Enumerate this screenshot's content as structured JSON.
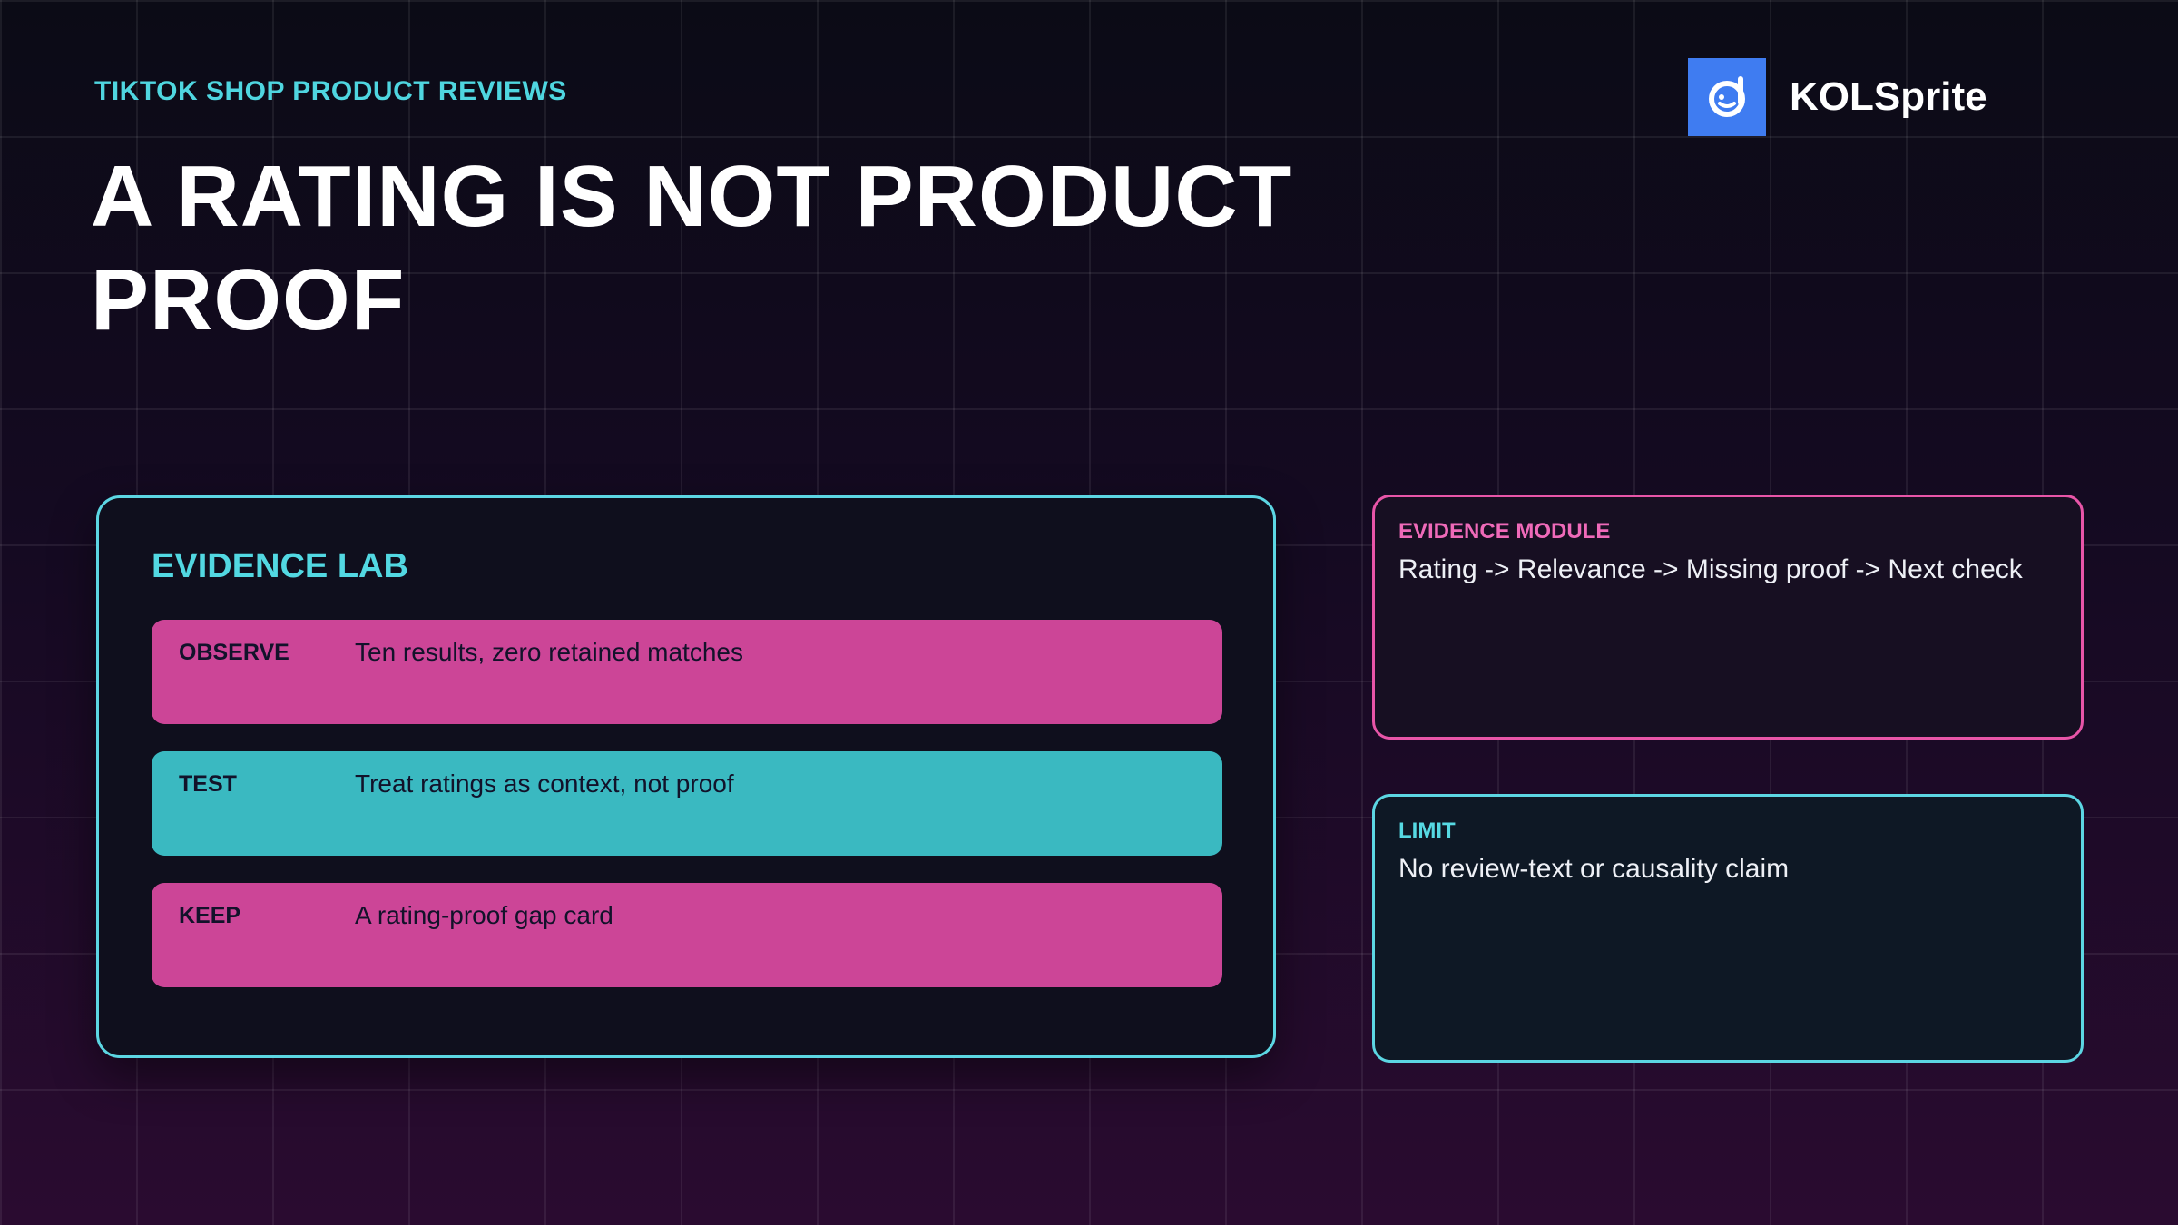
{
  "header": {
    "kicker": "TIKTOK SHOP PRODUCT REVIEWS",
    "title": "A RATING IS NOT PRODUCT PROOF"
  },
  "brand": {
    "name": "KOLSprite",
    "icon": "kolsprite-logo-icon",
    "color": "#3f7cf1"
  },
  "lab": {
    "title": "EVIDENCE LAB",
    "rows": [
      {
        "key": "OBSERVE",
        "value": "Ten results, zero retained matches",
        "color": "#cc4597"
      },
      {
        "key": "TEST",
        "value": "Treat ratings as context, not proof",
        "color": "#3ab9c1"
      },
      {
        "key": "KEEP",
        "value": "A rating-proof gap card",
        "color": "#cc4597"
      }
    ]
  },
  "evidence_module": {
    "label": "EVIDENCE MODULE",
    "text": "Rating -> Relevance -> Missing proof -> Next check"
  },
  "limit": {
    "label": "LIMIT",
    "text": "No review-text or causality claim"
  },
  "colors": {
    "accent_cyan": "#52d8e2",
    "accent_pink": "#e855a8"
  }
}
